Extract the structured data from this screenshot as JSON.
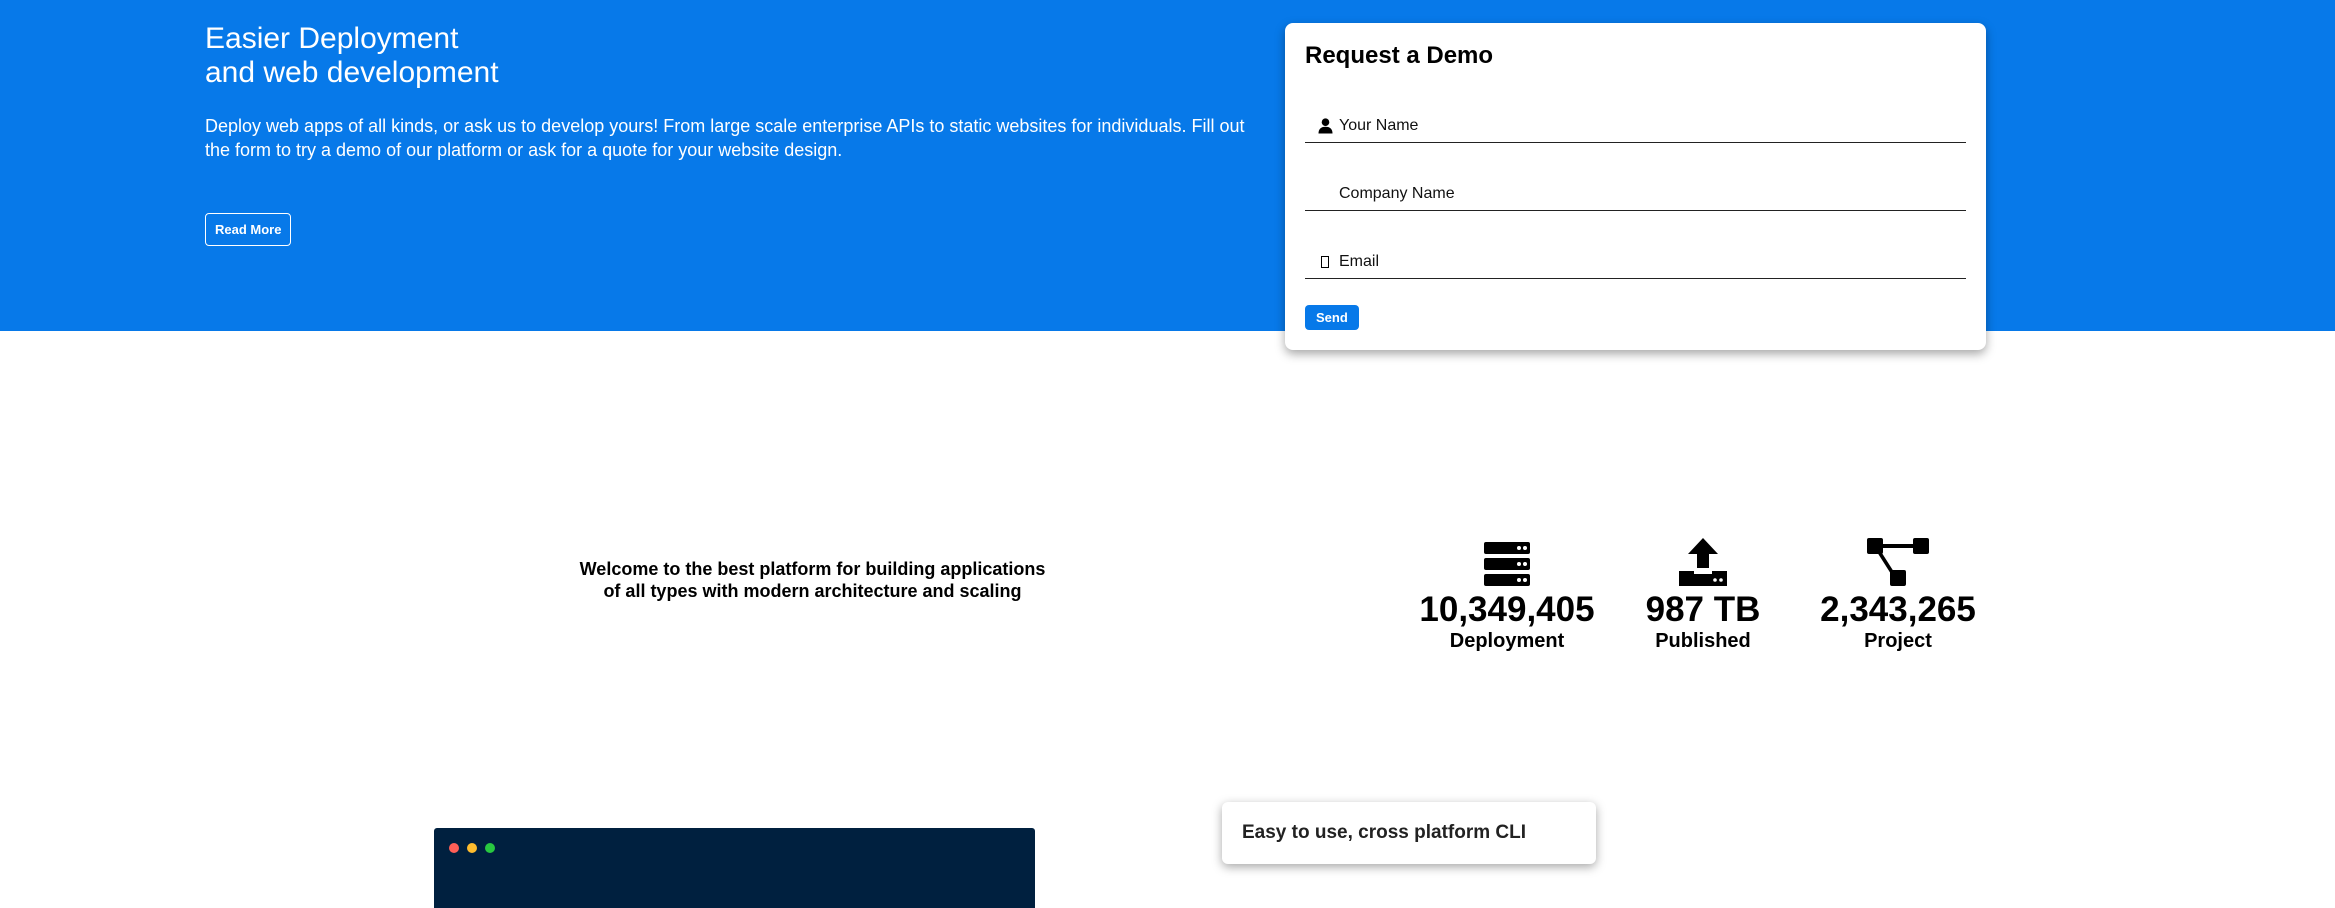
{
  "hero": {
    "title_line1": "Easier Deployment",
    "title_line2": "and web development",
    "description": "Deploy web apps of all kinds, or ask us to develop yours! From large scale enterprise APIs to static websites for individuals. Fill out the form to try a demo of our platform or ask for a quote for your website design.",
    "read_more_label": "Read More",
    "background_color": "#0779e9"
  },
  "demo_form": {
    "title": "Request a Demo",
    "name_placeholder": "Your Name",
    "company_placeholder": "Company Name",
    "email_placeholder": "Email",
    "send_label": "Send",
    "icons": {
      "name": "user-icon",
      "email": "mail-icon"
    }
  },
  "welcome": {
    "line1": "Welcome to the best platform for building applications",
    "line2": "of all types with modern architecture and scaling"
  },
  "stats": [
    {
      "icon": "server-icon",
      "value": "10,349,405",
      "label": "Deployment"
    },
    {
      "icon": "upload-icon",
      "value": "987 TB",
      "label": "Published"
    },
    {
      "icon": "project-diagram-icon",
      "value": "2,343,265",
      "label": "Project"
    }
  ],
  "terminal": {
    "background_color": "#00203f",
    "window_dot_colors": [
      "#ff5f57",
      "#febc2e",
      "#28c840"
    ]
  },
  "cli_card": {
    "title": "Easy to use, cross platform CLI"
  }
}
